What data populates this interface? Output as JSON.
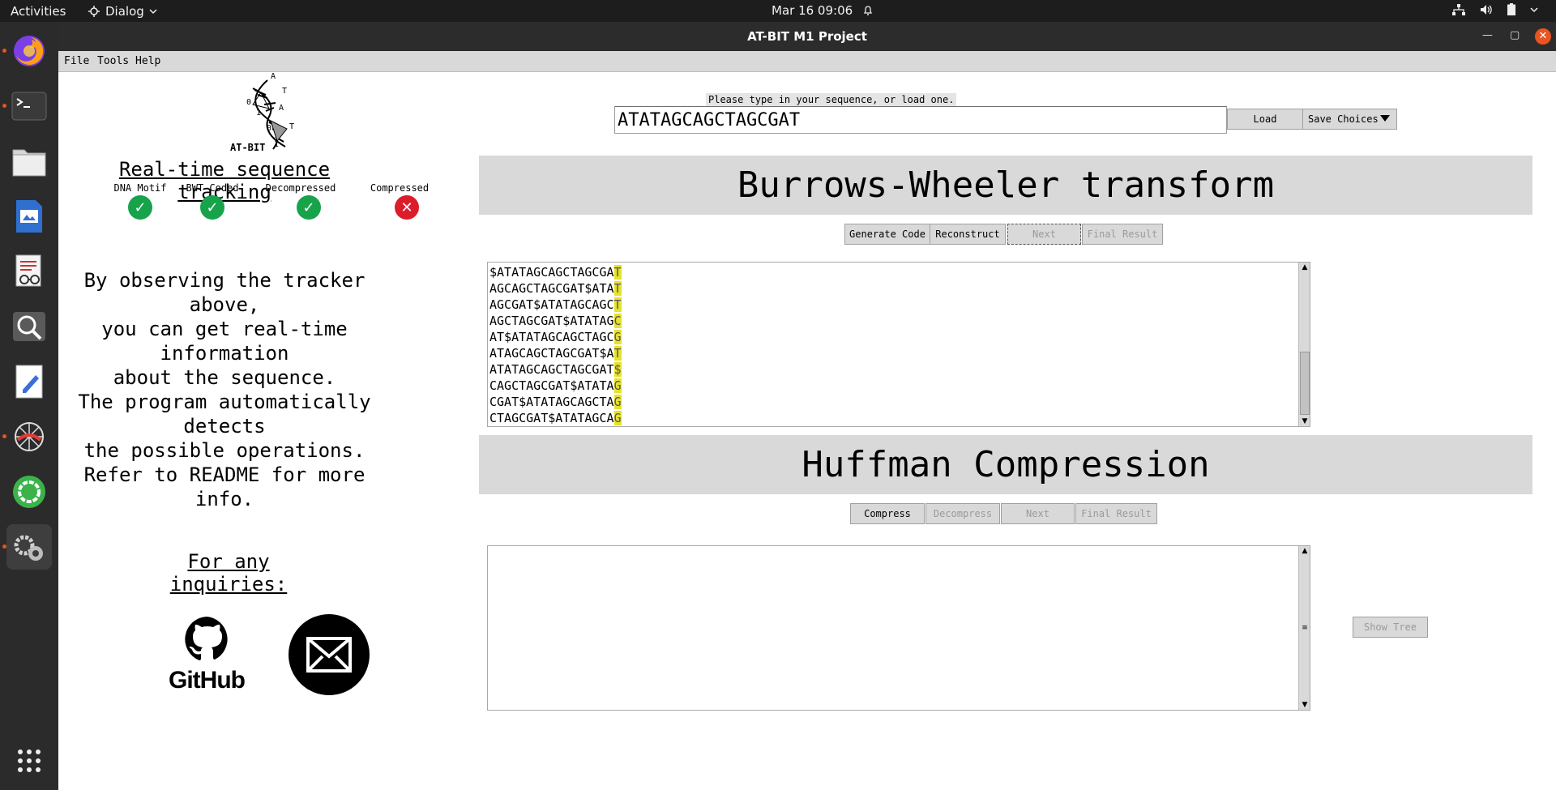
{
  "topbar": {
    "activities": "Activities",
    "app_menu": "Dialog",
    "datetime": "Mar 16  09:06"
  },
  "dock": {
    "items": [
      "firefox-icon",
      "terminal-icon",
      "files-icon",
      "libreoffice-impress-icon",
      "document-viewer-icon",
      "image-viewer-icon",
      "text-editor-icon",
      "spider-icon",
      "circle-app-icon",
      "settings-app-icon"
    ],
    "show_apps": "show-applications-icon"
  },
  "window": {
    "title": "AT-BIT M1 Project",
    "menu": [
      "File",
      "Tools",
      "Help"
    ]
  },
  "logo": {
    "text": "AT-BIT"
  },
  "tracker": {
    "title": "Real-time sequence tracking",
    "items": [
      {
        "label": "DNA Motif",
        "status": "ok"
      },
      {
        "label": "BWT Coded",
        "status": "ok"
      },
      {
        "label": "Decompressed",
        "status": "ok"
      },
      {
        "label": "Compressed",
        "status": "fail"
      }
    ],
    "ok_color": "#17a34a",
    "fail_color": "#dc1c2a"
  },
  "info": {
    "lines": [
      "By observing the tracker above,",
      "you can get real-time information",
      "about the sequence.",
      "The program automatically detects",
      "the possible operations.",
      "Refer to README for more info."
    ]
  },
  "contact": {
    "title": "For any inquiries:",
    "github_label": "GitHub"
  },
  "sequence": {
    "hint": "Please type in your sequence, or load one.",
    "value": "ATATAGCAGCTAGCGAT",
    "load_button": "Load",
    "save_button": "Save Choices"
  },
  "bwt": {
    "title": "Burrows-Wheeler transform",
    "buttons": {
      "generate": "Generate Code",
      "reconstruct": "Reconstruct",
      "next": "Next",
      "final": "Final Result"
    },
    "rows": [
      {
        "prefix": "$ATATAGCAGCTAGCGA",
        "last": "T"
      },
      {
        "prefix": "AGCAGCTAGCGAT$ATA",
        "last": "T"
      },
      {
        "prefix": "AGCGAT$ATATAGCAGC",
        "last": "T"
      },
      {
        "prefix": "AGCTAGCGAT$ATATAG",
        "last": "C"
      },
      {
        "prefix": "AT$ATATAGCAGCTAGC",
        "last": "G"
      },
      {
        "prefix": "ATAGCAGCTAGCGAT$A",
        "last": "T"
      },
      {
        "prefix": "ATATAGCAGCTAGCGAT",
        "last": "$"
      },
      {
        "prefix": "CAGCTAGCGAT$ATATA",
        "last": "G"
      },
      {
        "prefix": "CGAT$ATATAGCAGCTA",
        "last": "G"
      },
      {
        "prefix": "CTAGCGAT$ATATAGCA",
        "last": "G"
      }
    ],
    "highlight_color": "#e6e22a"
  },
  "huffman": {
    "title": "Huffman Compression",
    "buttons": {
      "compress": "Compress",
      "decompress": "Decompress",
      "next": "Next",
      "final": "Final Result"
    },
    "show_tree": "Show Tree"
  }
}
